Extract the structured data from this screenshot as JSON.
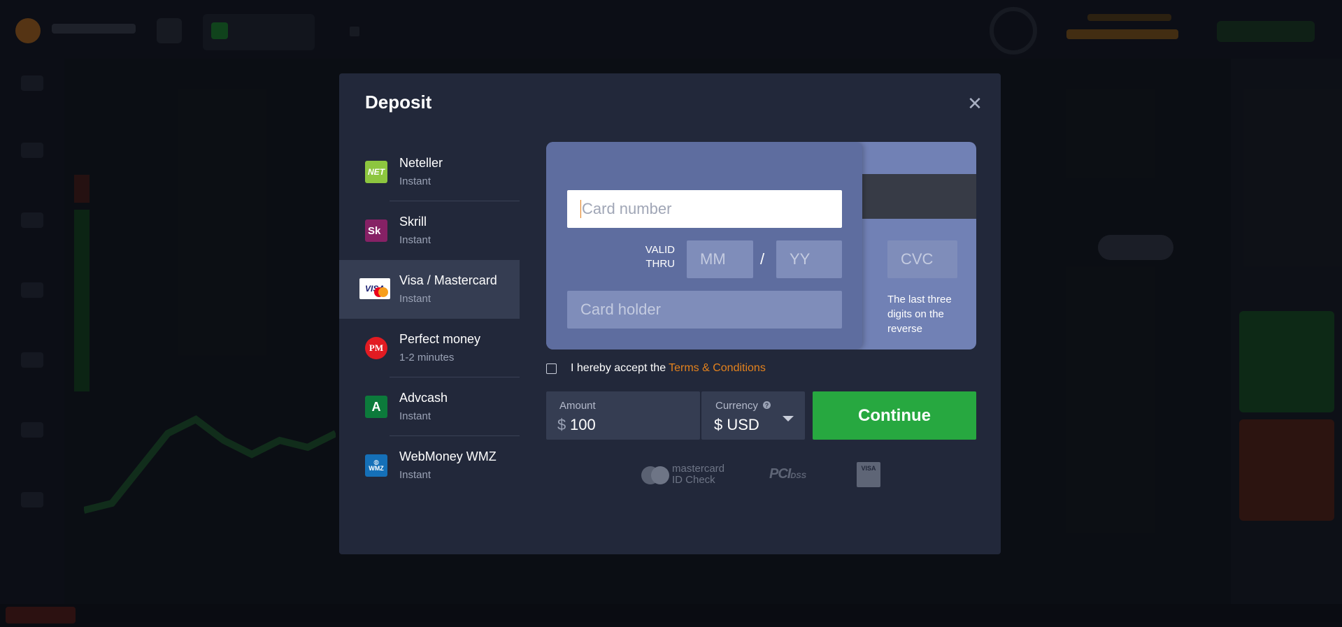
{
  "modal": {
    "title": "Deposit",
    "close_icon": "close-icon"
  },
  "methods": [
    {
      "name": "Neteller",
      "sub": "Instant",
      "icon": "neteller-icon",
      "icon_text": "NET",
      "selected": false
    },
    {
      "name": "Skrill",
      "sub": "Instant",
      "icon": "skrill-icon",
      "icon_text": "Sk",
      "selected": false
    },
    {
      "name": "Visa / Mastercard",
      "sub": "Instant",
      "icon": "visa-mastercard-icon",
      "icon_text": "VISA",
      "selected": true
    },
    {
      "name": "Perfect money",
      "sub": "1-2 minutes",
      "icon": "perfect-money-icon",
      "icon_text": "PM",
      "selected": false
    },
    {
      "name": "Advcash",
      "sub": "Instant",
      "icon": "advcash-icon",
      "icon_text": "A",
      "selected": false
    },
    {
      "name": "WebMoney WMZ",
      "sub": "Instant",
      "icon": "webmoney-icon",
      "icon_text": "WMZ",
      "selected": false
    }
  ],
  "card": {
    "number_placeholder": "Card number",
    "valid_thru_line1": "VALID",
    "valid_thru_line2": "THRU",
    "month_placeholder": "MM",
    "separator": "/",
    "year_placeholder": "YY",
    "holder_placeholder": "Card holder",
    "cvc_placeholder": "CVC",
    "cvc_hint": "The last three digits on the reverse"
  },
  "terms": {
    "text": "I hereby accept the",
    "link": "Terms & Conditions",
    "checked": false
  },
  "amount": {
    "label": "Amount",
    "currency_symbol": "$",
    "value": "100"
  },
  "currency": {
    "label": "Currency",
    "help": "?",
    "value": "$ USD"
  },
  "continue_label": "Continue",
  "security_logos": {
    "mastercard_line1": "mastercard",
    "mastercard_line2": "ID Check",
    "pci": "PCI",
    "pci_small": "DSS",
    "visa": "VISA"
  },
  "colors": {
    "modal_bg": "#22283a",
    "selected_method_bg": "#353d52",
    "card_front": "#5e6d9f",
    "card_back": "#7181b5",
    "accent_orange": "#e4821d",
    "continue_green": "#27a840"
  }
}
